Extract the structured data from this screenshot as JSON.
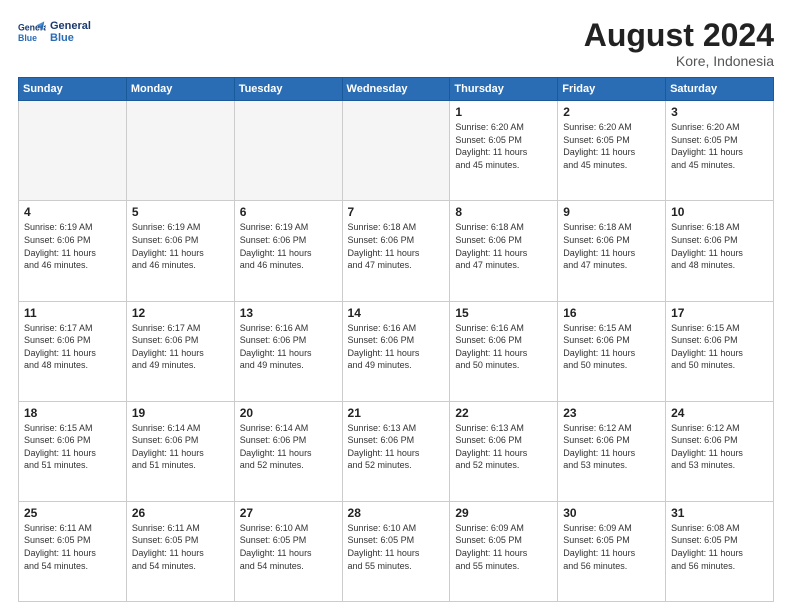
{
  "header": {
    "logo_line1": "General",
    "logo_line2": "Blue",
    "month_title": "August 2024",
    "location": "Kore, Indonesia"
  },
  "calendar": {
    "headers": [
      "Sunday",
      "Monday",
      "Tuesday",
      "Wednesday",
      "Thursday",
      "Friday",
      "Saturday"
    ],
    "weeks": [
      [
        {
          "day": "",
          "info": ""
        },
        {
          "day": "",
          "info": ""
        },
        {
          "day": "",
          "info": ""
        },
        {
          "day": "",
          "info": ""
        },
        {
          "day": "1",
          "info": "Sunrise: 6:20 AM\nSunset: 6:05 PM\nDaylight: 11 hours\nand 45 minutes."
        },
        {
          "day": "2",
          "info": "Sunrise: 6:20 AM\nSunset: 6:05 PM\nDaylight: 11 hours\nand 45 minutes."
        },
        {
          "day": "3",
          "info": "Sunrise: 6:20 AM\nSunset: 6:05 PM\nDaylight: 11 hours\nand 45 minutes."
        }
      ],
      [
        {
          "day": "4",
          "info": "Sunrise: 6:19 AM\nSunset: 6:06 PM\nDaylight: 11 hours\nand 46 minutes."
        },
        {
          "day": "5",
          "info": "Sunrise: 6:19 AM\nSunset: 6:06 PM\nDaylight: 11 hours\nand 46 minutes."
        },
        {
          "day": "6",
          "info": "Sunrise: 6:19 AM\nSunset: 6:06 PM\nDaylight: 11 hours\nand 46 minutes."
        },
        {
          "day": "7",
          "info": "Sunrise: 6:18 AM\nSunset: 6:06 PM\nDaylight: 11 hours\nand 47 minutes."
        },
        {
          "day": "8",
          "info": "Sunrise: 6:18 AM\nSunset: 6:06 PM\nDaylight: 11 hours\nand 47 minutes."
        },
        {
          "day": "9",
          "info": "Sunrise: 6:18 AM\nSunset: 6:06 PM\nDaylight: 11 hours\nand 47 minutes."
        },
        {
          "day": "10",
          "info": "Sunrise: 6:18 AM\nSunset: 6:06 PM\nDaylight: 11 hours\nand 48 minutes."
        }
      ],
      [
        {
          "day": "11",
          "info": "Sunrise: 6:17 AM\nSunset: 6:06 PM\nDaylight: 11 hours\nand 48 minutes."
        },
        {
          "day": "12",
          "info": "Sunrise: 6:17 AM\nSunset: 6:06 PM\nDaylight: 11 hours\nand 49 minutes."
        },
        {
          "day": "13",
          "info": "Sunrise: 6:16 AM\nSunset: 6:06 PM\nDaylight: 11 hours\nand 49 minutes."
        },
        {
          "day": "14",
          "info": "Sunrise: 6:16 AM\nSunset: 6:06 PM\nDaylight: 11 hours\nand 49 minutes."
        },
        {
          "day": "15",
          "info": "Sunrise: 6:16 AM\nSunset: 6:06 PM\nDaylight: 11 hours\nand 50 minutes."
        },
        {
          "day": "16",
          "info": "Sunrise: 6:15 AM\nSunset: 6:06 PM\nDaylight: 11 hours\nand 50 minutes."
        },
        {
          "day": "17",
          "info": "Sunrise: 6:15 AM\nSunset: 6:06 PM\nDaylight: 11 hours\nand 50 minutes."
        }
      ],
      [
        {
          "day": "18",
          "info": "Sunrise: 6:15 AM\nSunset: 6:06 PM\nDaylight: 11 hours\nand 51 minutes."
        },
        {
          "day": "19",
          "info": "Sunrise: 6:14 AM\nSunset: 6:06 PM\nDaylight: 11 hours\nand 51 minutes."
        },
        {
          "day": "20",
          "info": "Sunrise: 6:14 AM\nSunset: 6:06 PM\nDaylight: 11 hours\nand 52 minutes."
        },
        {
          "day": "21",
          "info": "Sunrise: 6:13 AM\nSunset: 6:06 PM\nDaylight: 11 hours\nand 52 minutes."
        },
        {
          "day": "22",
          "info": "Sunrise: 6:13 AM\nSunset: 6:06 PM\nDaylight: 11 hours\nand 52 minutes."
        },
        {
          "day": "23",
          "info": "Sunrise: 6:12 AM\nSunset: 6:06 PM\nDaylight: 11 hours\nand 53 minutes."
        },
        {
          "day": "24",
          "info": "Sunrise: 6:12 AM\nSunset: 6:06 PM\nDaylight: 11 hours\nand 53 minutes."
        }
      ],
      [
        {
          "day": "25",
          "info": "Sunrise: 6:11 AM\nSunset: 6:05 PM\nDaylight: 11 hours\nand 54 minutes."
        },
        {
          "day": "26",
          "info": "Sunrise: 6:11 AM\nSunset: 6:05 PM\nDaylight: 11 hours\nand 54 minutes."
        },
        {
          "day": "27",
          "info": "Sunrise: 6:10 AM\nSunset: 6:05 PM\nDaylight: 11 hours\nand 54 minutes."
        },
        {
          "day": "28",
          "info": "Sunrise: 6:10 AM\nSunset: 6:05 PM\nDaylight: 11 hours\nand 55 minutes."
        },
        {
          "day": "29",
          "info": "Sunrise: 6:09 AM\nSunset: 6:05 PM\nDaylight: 11 hours\nand 55 minutes."
        },
        {
          "day": "30",
          "info": "Sunrise: 6:09 AM\nSunset: 6:05 PM\nDaylight: 11 hours\nand 56 minutes."
        },
        {
          "day": "31",
          "info": "Sunrise: 6:08 AM\nSunset: 6:05 PM\nDaylight: 11 hours\nand 56 minutes."
        }
      ]
    ]
  }
}
